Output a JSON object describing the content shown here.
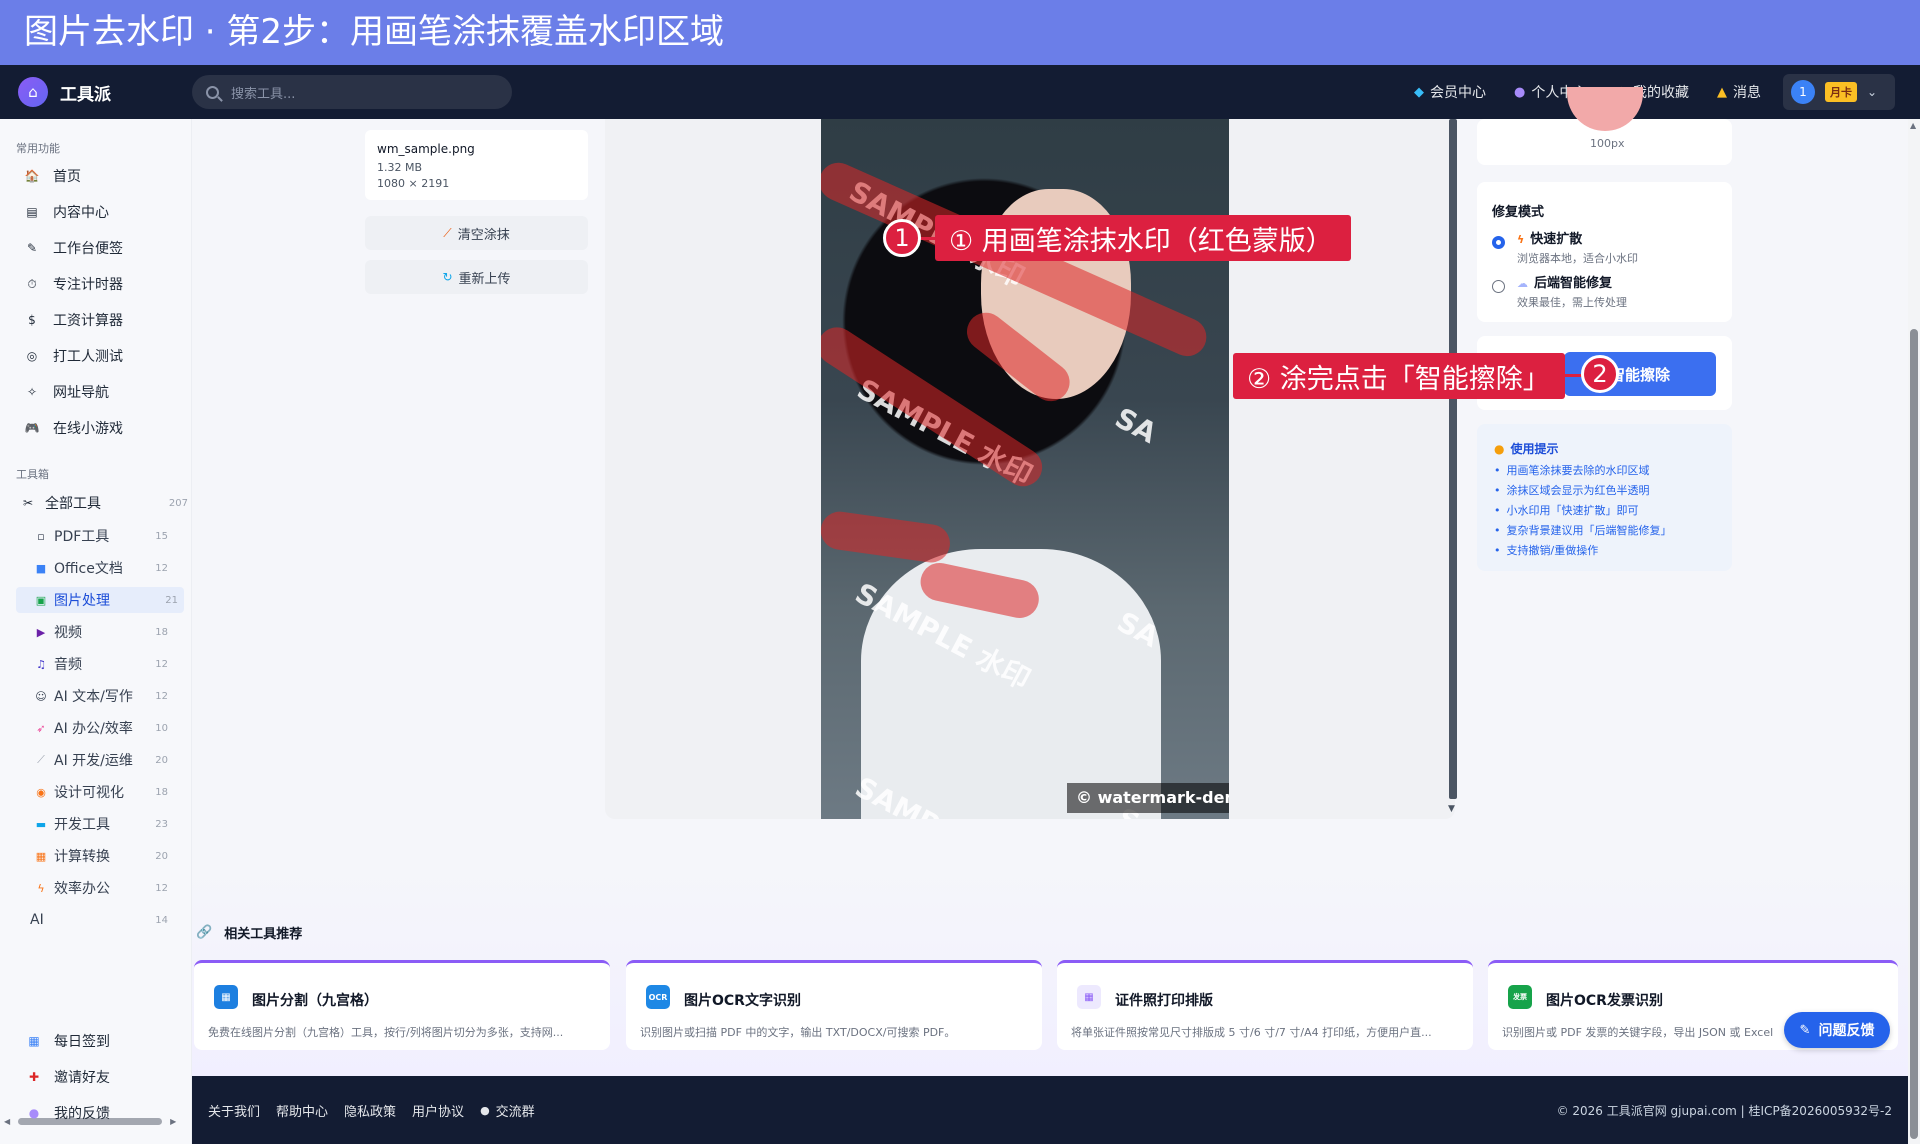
{
  "banner": {
    "title": "图片去水印 · 第2步：用画笔涂抹覆盖水印区域"
  },
  "topnav": {
    "brand": "工具派",
    "search_placeholder": "搜索工具...",
    "links": [
      {
        "label": "会员中心",
        "icon": "diamond-icon"
      },
      {
        "label": "个人中心",
        "icon": "user-icon"
      },
      {
        "label": "我的收藏",
        "icon": "star-icon"
      },
      {
        "label": "消息",
        "icon": "bell-icon"
      }
    ],
    "user_avatar": "1",
    "user_badge": "月卡"
  },
  "sidebar": {
    "common_title": "常用功能",
    "common_items": [
      {
        "label": "首页",
        "icon": "home-icon"
      },
      {
        "label": "内容中心",
        "icon": "content-icon"
      },
      {
        "label": "工作台便签",
        "icon": "note-icon"
      },
      {
        "label": "专注计时器",
        "icon": "timer-icon"
      },
      {
        "label": "工资计算器",
        "icon": "money-bag-icon"
      },
      {
        "label": "打工人测试",
        "icon": "target-icon"
      },
      {
        "label": "网址导航",
        "icon": "compass-icon"
      },
      {
        "label": "在线小游戏",
        "icon": "gamepad-icon"
      }
    ],
    "toolbox_title": "工具箱",
    "all_tools": {
      "label": "全部工具",
      "count": "207"
    },
    "tools": [
      {
        "label": "PDF工具",
        "count": "15"
      },
      {
        "label": "Office文档",
        "count": "12"
      },
      {
        "label": "图片处理",
        "count": "21"
      },
      {
        "label": "视频",
        "count": "18"
      },
      {
        "label": "音频",
        "count": "12"
      },
      {
        "label": "AI 文本/写作",
        "count": "12"
      },
      {
        "label": "AI 办公/效率",
        "count": "10"
      },
      {
        "label": "AI 开发/运维",
        "count": "20"
      },
      {
        "label": "设计可视化",
        "count": "18"
      },
      {
        "label": "开发工具",
        "count": "23"
      },
      {
        "label": "计算转换",
        "count": "20"
      },
      {
        "label": "效率办公",
        "count": "12"
      },
      {
        "label": "AI",
        "count": "14"
      }
    ],
    "bottom_items": [
      {
        "label": "每日签到",
        "icon": "calendar-icon"
      },
      {
        "label": "邀请好友",
        "icon": "gift-icon"
      },
      {
        "label": "我的反馈",
        "icon": "chat-icon"
      }
    ]
  },
  "file": {
    "name": "wm_sample.png",
    "size": "1.32 MB",
    "dims": "1080 × 2191"
  },
  "actions": {
    "clear": "清空涂抹",
    "reupload": "重新上传"
  },
  "photo": {
    "watermark": "SAMPLE 水印",
    "watermark_clipped": "SA",
    "credit": "© watermark-demo"
  },
  "brush": {
    "size_label": "100px"
  },
  "repair": {
    "title": "修复模式",
    "options": [
      {
        "label": "快速扩散",
        "desc": "浏览器本地，适合小水印",
        "selected": true
      },
      {
        "label": "后端智能修复",
        "desc": "效果最佳，需上传处理",
        "selected": false
      }
    ],
    "erase_button": "智能擦除"
  },
  "tips": {
    "title": "使用提示",
    "items": [
      "用画笔涂抹要去除的水印区域",
      "涂抹区域会显示为红色半透明",
      "小水印用「快速扩散」即可",
      "复杂背景建议用「后端智能修复」",
      "支持撤销/重做操作"
    ]
  },
  "annotations": {
    "step1": "① 用画笔涂抹水印（红色蒙版）",
    "step1_num": "1",
    "step2": "② 涂完点击「智能擦除」",
    "step2_num": "2"
  },
  "related": {
    "title": "相关工具推荐",
    "cards": [
      {
        "name": "图片分割（九宫格）",
        "desc": "免费在线图片分割（九宫格）工具，按行/列将图片切分为多张，支持网...",
        "color": "#1d7fe0",
        "icon_text": "▦"
      },
      {
        "name": "图片OCR文字识别",
        "desc": "识别图片或扫描 PDF 中的文字，输出 TXT/DOCX/可搜索 PDF。",
        "color": "#1e88e5",
        "icon_text": "OCR"
      },
      {
        "name": "证件照打印排版",
        "desc": "将单张证件照按常见尺寸排版成 5 寸/6 寸/7 寸/A4 打印纸，方便用户直...",
        "color": "#8b5cf6",
        "icon_text": "▦"
      },
      {
        "name": "图片OCR发票识别",
        "desc": "识别图片或 PDF 发票的关键字段，导出 JSON 或 Excel",
        "color": "#16a34a",
        "icon_text": "发票"
      }
    ]
  },
  "feedback": "问题反馈",
  "footer": {
    "links": [
      "关于我们",
      "帮助中心",
      "隐私政策",
      "用户协议",
      "交流群"
    ],
    "copyright": "© 2026 工具派官网 gjupai.com | 桂ICP备2026005932号-2"
  }
}
